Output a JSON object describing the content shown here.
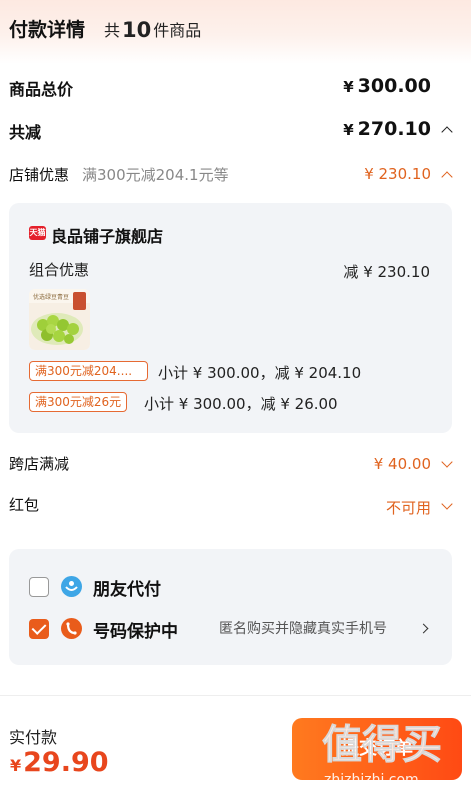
{
  "header": {
    "title": "付款详情",
    "count_prefix": "共",
    "count": "10",
    "count_suffix": "件商品"
  },
  "summary": {
    "total_label": "商品总价",
    "total_yen": "¥",
    "total_value": "300.00",
    "discount_label": "共减",
    "discount_yen": "¥",
    "discount_value": "270.10"
  },
  "store_discount": {
    "label": "店铺优惠",
    "desc": "满300元减204.1元等",
    "amount": "¥ 230.10"
  },
  "shop": {
    "badge": "天猫",
    "name": "良品铺子旗舰店",
    "combo_label": "组合优惠",
    "combo_amount": "减 ¥ 230.10",
    "product_caption": "优选绿豆青豆",
    "promos": [
      {
        "tag": "满300元减204....",
        "text": "小计 ¥ 300.00，减 ¥ 204.10"
      },
      {
        "tag": "满300元减26元",
        "text": "小计 ¥ 300.00，减 ¥ 26.00"
      }
    ]
  },
  "cross_store": {
    "label": "跨店满减",
    "amount": "¥ 40.00"
  },
  "red_packet": {
    "label": "红包",
    "value": "不可用"
  },
  "options": {
    "friend_pay": {
      "label": "朋友代付",
      "checked": false
    },
    "privacy": {
      "label": "号码保护中",
      "checked": true,
      "desc": "匿名购买并隐藏真实手机号"
    }
  },
  "footer": {
    "pay_label": "实付款",
    "pay_yen": "¥",
    "pay_value": "29.90",
    "submit_label": "提交订单"
  },
  "watermark": {
    "text": "值得买",
    "url_text": "zhizhizhi.com"
  },
  "colors": {
    "accent": "#e0631f",
    "pay": "#e8461d",
    "button": "#ff5a16",
    "panel": "#f2f4f7"
  }
}
